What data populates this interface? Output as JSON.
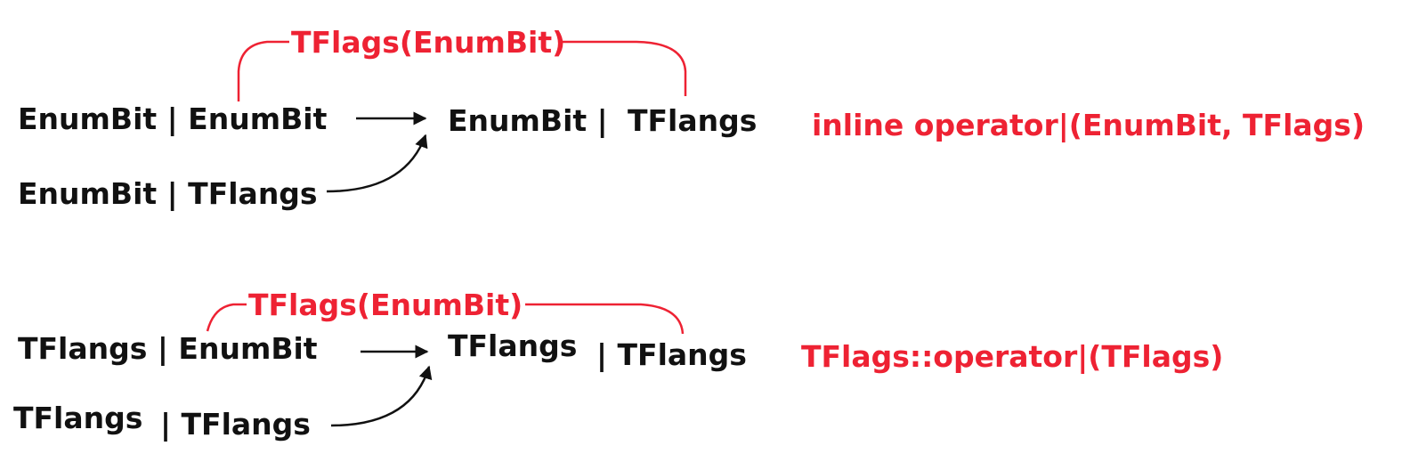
{
  "colors": {
    "text": "#111111",
    "accent": "#ee2233",
    "background": "#ffffff"
  },
  "section1": {
    "input1": "EnumBit | EnumBit",
    "input2": "EnumBit | TFlangs",
    "result_left": "EnumBit |",
    "result_right": "TFlangs",
    "conversion": "TFlags(EnumBit)",
    "operator": "inline operator|(EnumBit, TFlags)"
  },
  "section2": {
    "input1": "TFlangs | EnumBit",
    "input2_left": "TFlangs",
    "input2_right": "| TFlangs",
    "result_left": "TFlangs",
    "result_right": "| TFlangs",
    "conversion": "TFlags(EnumBit)",
    "operator": "TFlags::operator|(TFlags)"
  }
}
